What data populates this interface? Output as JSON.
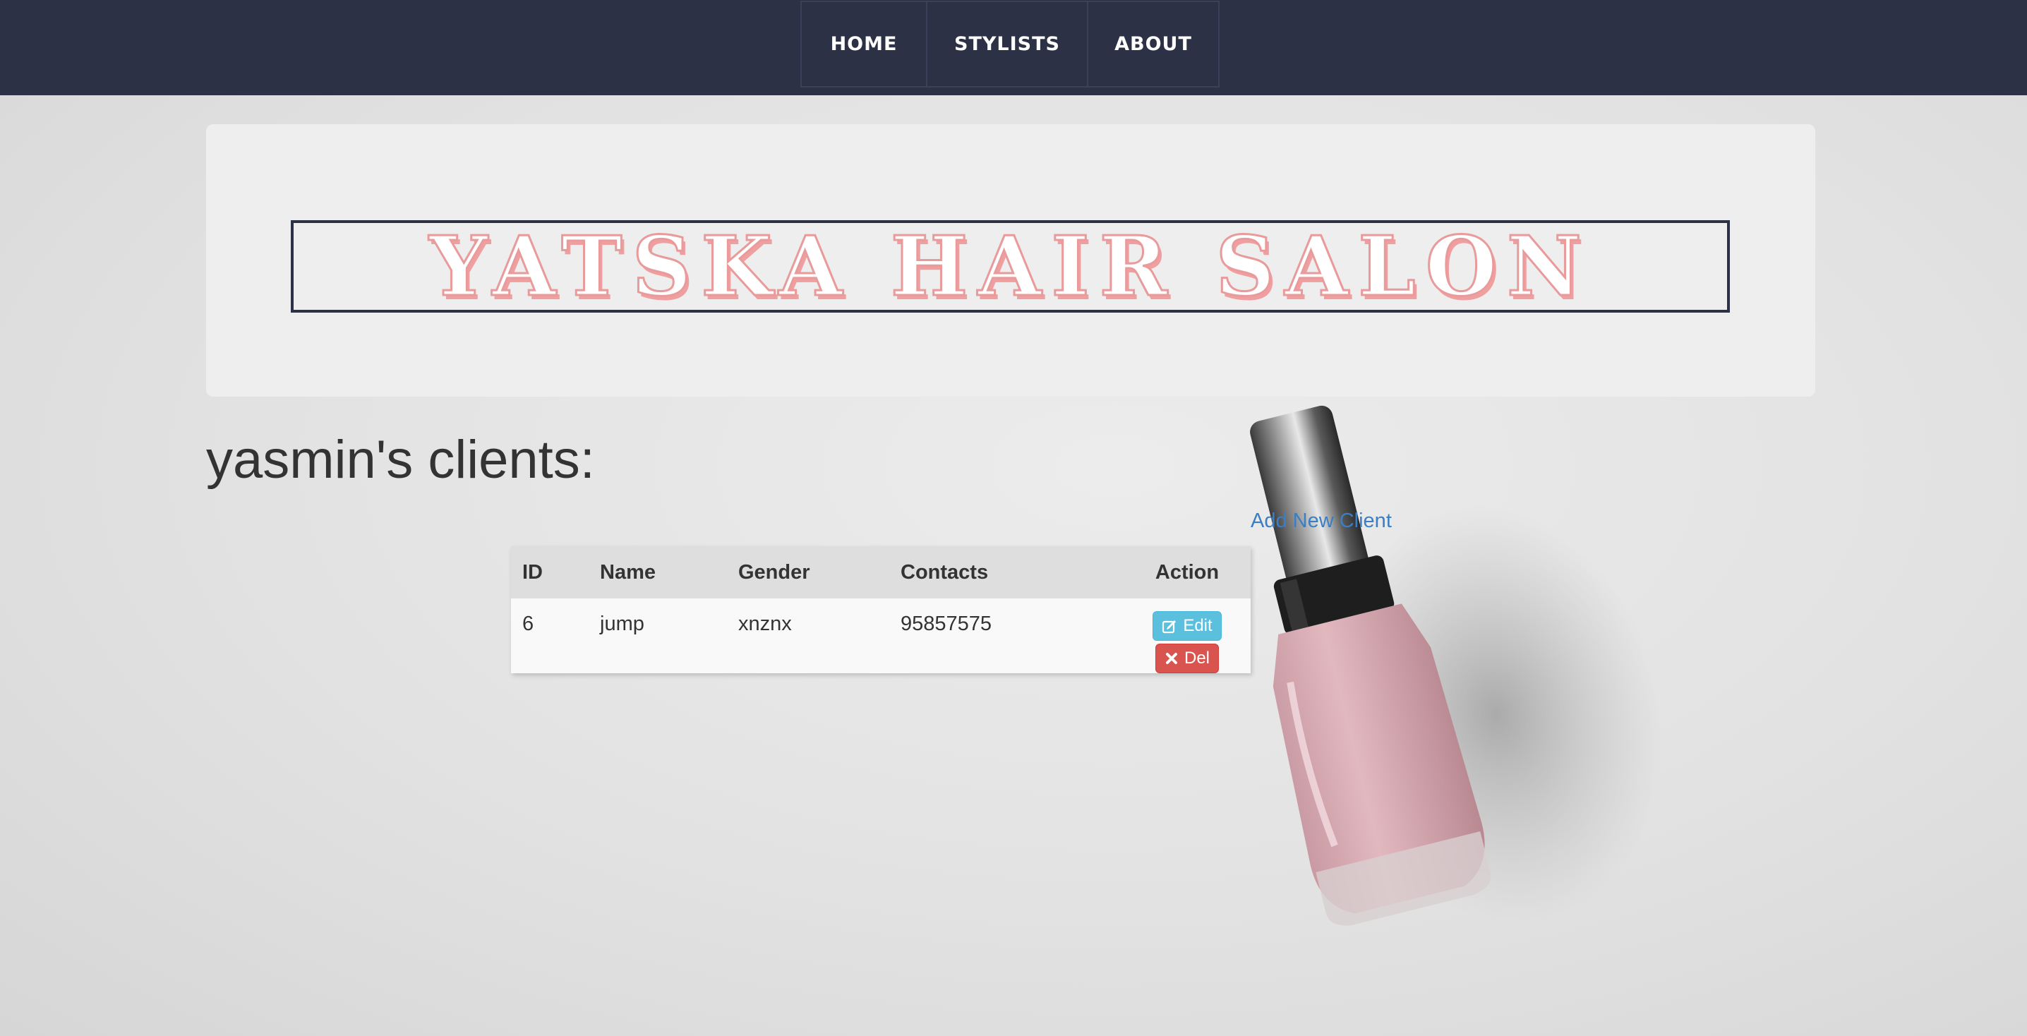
{
  "nav": {
    "items": [
      {
        "label": "HOME"
      },
      {
        "label": "STYLISTS"
      },
      {
        "label": "ABOUT"
      }
    ]
  },
  "header": {
    "title": "YATSKA HAIR SALON"
  },
  "main": {
    "heading": "yasmin's clients:",
    "add_client_label": "Add New Client",
    "table": {
      "columns": [
        "ID",
        "Name",
        "Gender",
        "Contacts",
        "Action"
      ],
      "rows": [
        {
          "id": "6",
          "name": "jump",
          "gender": "xnznx",
          "contacts": "95857575"
        }
      ]
    },
    "actions": {
      "edit_label": "Edit",
      "delete_label": "Del"
    }
  },
  "colors": {
    "navbar": "#2c3145",
    "title_pink": "#e99a9a",
    "link_blue": "#3a7fc4",
    "edit_button": "#5bc0de",
    "delete_button": "#d9534f"
  },
  "icons": {
    "edit": "edit-square-icon",
    "delete": "close-x-icon"
  }
}
